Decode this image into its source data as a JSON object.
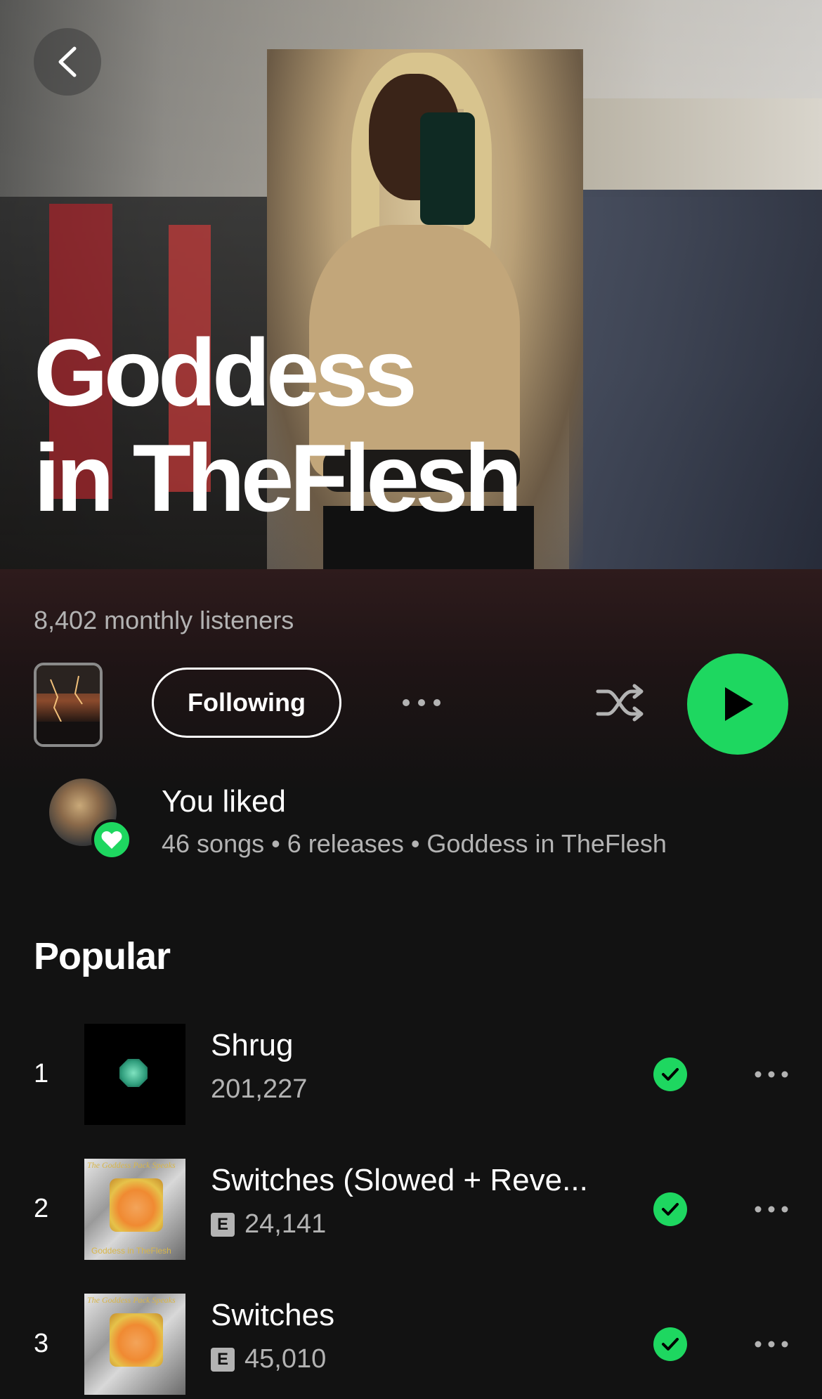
{
  "artist": {
    "name_line1": "Goddess",
    "name_line2": "in TheFlesh",
    "monthly_listeners": "8,402 monthly listeners"
  },
  "actions": {
    "follow_label": "Following",
    "more_icon": "more-horizontal-icon",
    "shuffle_icon": "shuffle-icon",
    "play_icon": "play-icon"
  },
  "liked": {
    "title": "You liked",
    "summary": "46 songs • 6 releases • Goddess in TheFlesh"
  },
  "popular": {
    "title": "Popular",
    "tracks": [
      {
        "rank": "1",
        "title": "Shrug",
        "plays": "201,227",
        "explicit": false
      },
      {
        "rank": "2",
        "title": "Switches (Slowed + Reve...",
        "plays": "24,141",
        "explicit": true,
        "explicit_label": "E"
      },
      {
        "rank": "3",
        "title": "Switches",
        "plays": "45,010",
        "explicit": true,
        "explicit_label": "E"
      }
    ]
  },
  "cover_art": {
    "switches_top_text": "The Goddess Pack Speaks",
    "switches_bottom_text": "Goddess in TheFlesh"
  },
  "colors": {
    "accent": "#1ed760",
    "background": "#121212",
    "secondary_text": "#b3b3b3"
  }
}
